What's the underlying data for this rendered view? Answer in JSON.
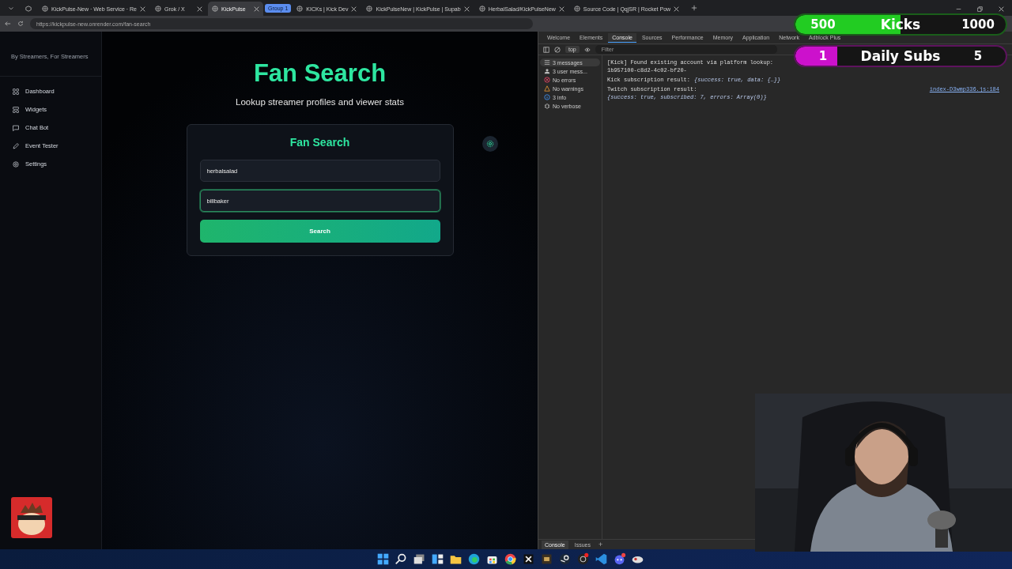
{
  "browser": {
    "tabs": [
      {
        "kind": "tab",
        "label": "KickPulse-New · Web Service · Re",
        "selected": false
      },
      {
        "kind": "tab",
        "label": "Grok / X",
        "selected": false
      },
      {
        "kind": "tab",
        "label": "KickPulse",
        "selected": true
      },
      {
        "kind": "group",
        "label": "Group 1"
      },
      {
        "kind": "tab",
        "label": "KICKs | Kick Dev",
        "selected": false
      },
      {
        "kind": "tab",
        "label": "KickPulseNew | KickPulse | Supab",
        "selected": false
      },
      {
        "kind": "tab",
        "label": "HerbalSalad/KickPulseNew",
        "selected": false
      },
      {
        "kind": "tab",
        "label": "Source Code | QqjSR | Rocket Pow",
        "selected": false
      }
    ],
    "address": "https://kickpulse-new.onrender.com/fan-search"
  },
  "sidebar": {
    "tagline": "By Streamers, For Streamers",
    "items": [
      {
        "label": "Dashboard",
        "selected": false
      },
      {
        "label": "Widgets",
        "selected": false
      },
      {
        "label": "Chat Bot",
        "selected": false
      },
      {
        "label": "Event Tester",
        "selected": false
      },
      {
        "label": "Settings",
        "selected": false
      }
    ]
  },
  "main": {
    "title": "Fan Search",
    "subtitle": "Lookup streamer profiles and viewer stats",
    "card": {
      "title": "Fan Search",
      "fields": [
        {
          "value": "herbalsalad",
          "focused": false
        },
        {
          "value": "billbaker",
          "focused": true
        }
      ],
      "button": "Search"
    }
  },
  "devtools": {
    "tabs": [
      {
        "label": "Welcome",
        "selected": false
      },
      {
        "label": "Elements",
        "selected": false
      },
      {
        "label": "Console",
        "selected": true
      },
      {
        "label": "Sources",
        "selected": false
      },
      {
        "label": "Performance",
        "selected": false
      },
      {
        "label": "Memory",
        "selected": false
      },
      {
        "label": "Application",
        "selected": false
      },
      {
        "label": "Network",
        "selected": false
      },
      {
        "label": "Adblock Plus",
        "selected": false
      }
    ],
    "context": "top",
    "filter_placeholder": "Filter",
    "filters": [
      {
        "label": "3 messages",
        "selected": true
      },
      {
        "label": "3 user mess...",
        "selected": false
      },
      {
        "label": "No errors",
        "selected": false
      },
      {
        "label": "No warnings",
        "selected": false
      },
      {
        "label": "3 info",
        "selected": false
      },
      {
        "label": "No verbose",
        "selected": false
      }
    ],
    "messages": [
      {
        "text": "[Kick] Found existing account via platform lookup: 1b957100-c8d2-4c02-bf20-"
      },
      {
        "text": "Kick subscription result:",
        "object": "{success: true, data: {…}}"
      },
      {
        "text": "Twitch subscription result:",
        "object": "{success: true, subscribed: 7, errors: Array(0)}",
        "source": "index-D3wmp336.js:184"
      }
    ],
    "drawer_tabs": [
      {
        "label": "Console",
        "selected": true
      },
      {
        "label": "Issues",
        "selected": false
      }
    ],
    "add_tab": "+"
  },
  "overlay": {
    "goals": [
      {
        "current": "500",
        "label": "Kicks",
        "target": "1000",
        "level": 0.5,
        "color": "#22cc22"
      },
      {
        "current": "1",
        "label": "Daily Subs",
        "target": "5",
        "level": 0.2,
        "color": "#cc11cc"
      }
    ]
  }
}
